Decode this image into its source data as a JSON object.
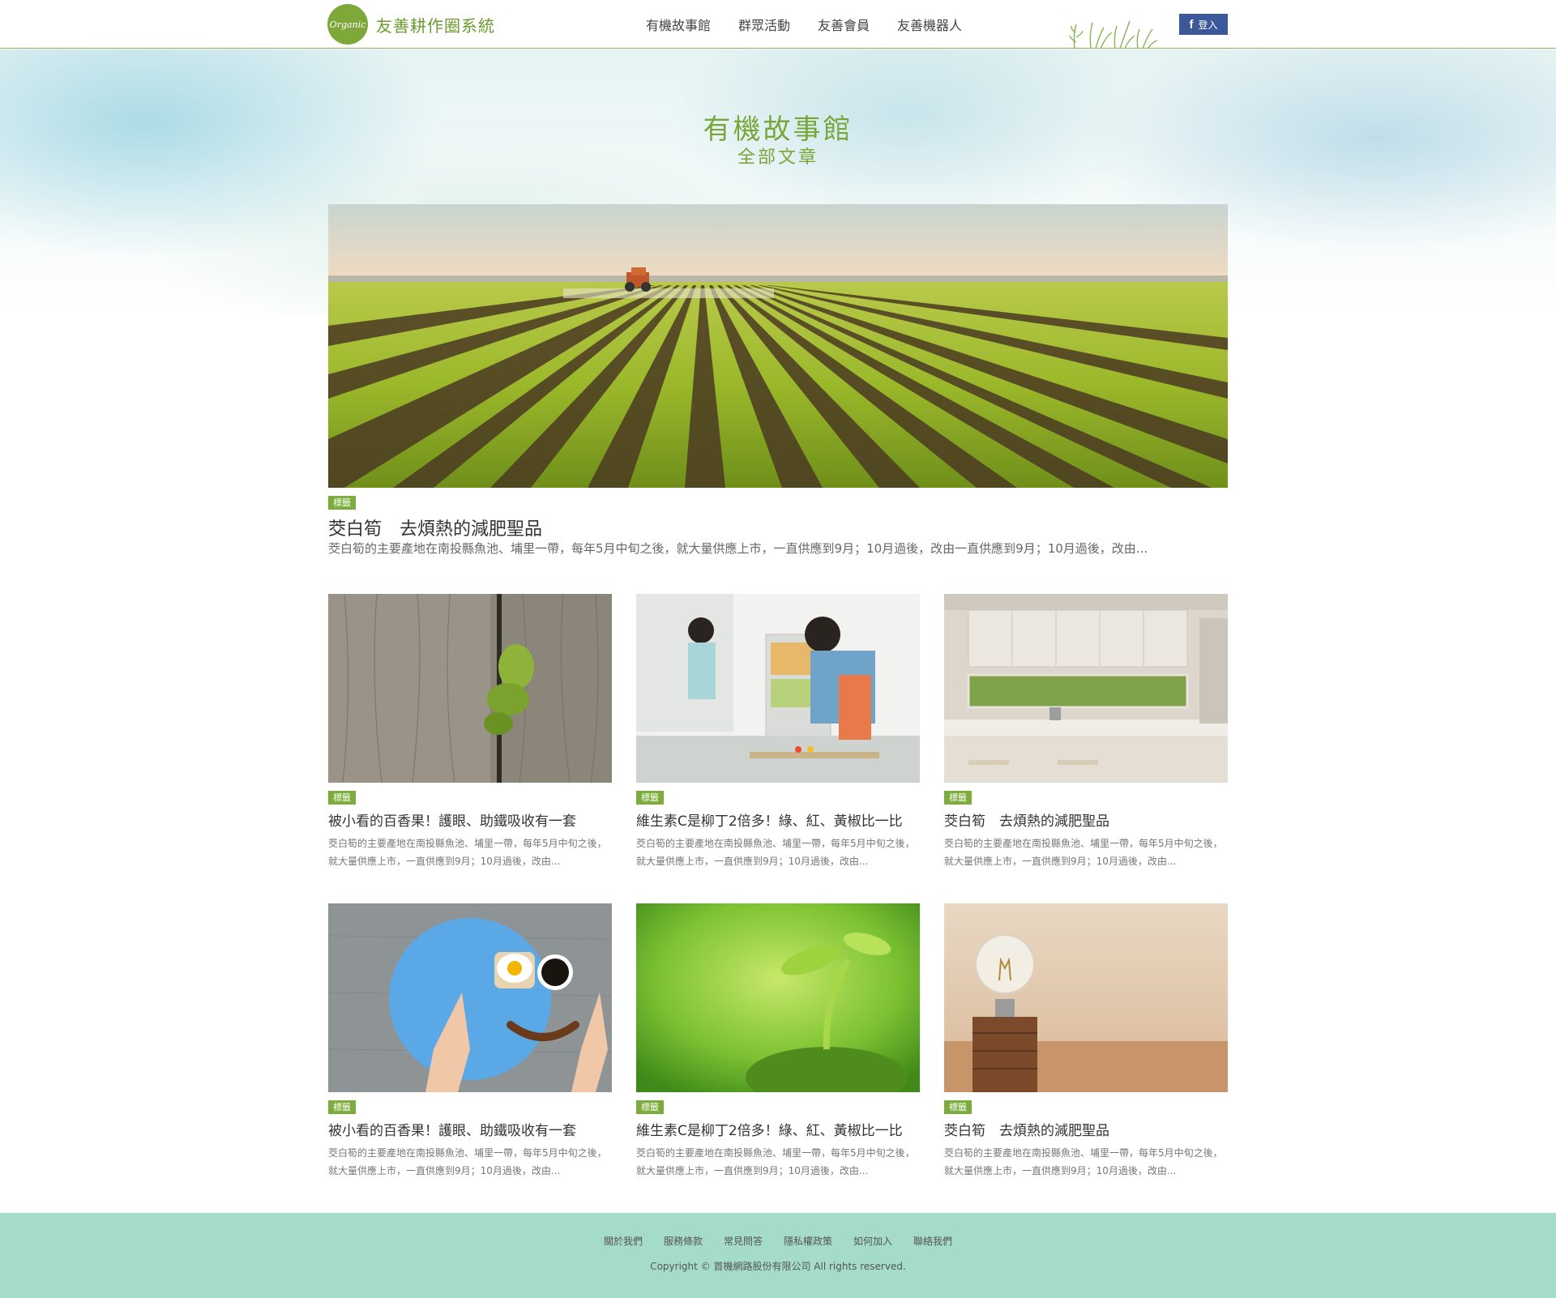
{
  "brand": {
    "logo_text": "Organic",
    "name": "友善耕作圈系統",
    "accent": "#79a63a"
  },
  "nav": {
    "items": [
      "有機故事館",
      "群眾活動",
      "友善會員",
      "友善機器人"
    ]
  },
  "fb_login": {
    "icon": "facebook-icon",
    "label": "登入",
    "color": "#3b5998"
  },
  "hero": {
    "title": "有機故事館",
    "subtitle": "全部文章"
  },
  "featured": {
    "tag": "標籤",
    "title": "茭白筍　去煩熱的減肥聖品",
    "excerpt": "茭白筍的主要產地在南投縣魚池、埔里一帶，每年5月中旬之後，就大量供應上市，一直供應到9月；10月過後，改由一直供應到9月；10月過後，改由..."
  },
  "cards": [
    {
      "tag": "標籤",
      "title": "被小看的百香果！護眼、助鐵吸收有一套",
      "excerpt": "茭白筍的主要產地在南投縣魚池、埔里一帶，每年5月中旬之後，就大量供應上市，一直供應到9月；10月過後，改由..."
    },
    {
      "tag": "標籤",
      "title": "維生素C是柳丁2倍多！綠、紅、黃椒比一比",
      "excerpt": "茭白筍的主要產地在南投縣魚池、埔里一帶，每年5月中旬之後，就大量供應上市，一直供應到9月；10月過後，改由..."
    },
    {
      "tag": "標籤",
      "title": "茭白筍　去煩熱的減肥聖品",
      "excerpt": "茭白筍的主要產地在南投縣魚池、埔里一帶，每年5月中旬之後，就大量供應上市，一直供應到9月；10月過後，改由..."
    },
    {
      "tag": "標籤",
      "title": "被小看的百香果！護眼、助鐵吸收有一套",
      "excerpt": "茭白筍的主要產地在南投縣魚池、埔里一帶，每年5月中旬之後，就大量供應上市，一直供應到9月；10月過後，改由..."
    },
    {
      "tag": "標籤",
      "title": "維生素C是柳丁2倍多！綠、紅、黃椒比一比",
      "excerpt": "茭白筍的主要產地在南投縣魚池、埔里一帶，每年5月中旬之後，就大量供應上市，一直供應到9月；10月過後，改由..."
    },
    {
      "tag": "標籤",
      "title": "茭白筍　去煩熱的減肥聖品",
      "excerpt": "茭白筍的主要產地在南投縣魚池、埔里一帶，每年5月中旬之後，就大量供應上市，一直供應到9月；10月過後，改由..."
    }
  ],
  "footer": {
    "links": [
      "關於我們",
      "服務條款",
      "常見問答",
      "隱私權政策",
      "如何加入",
      "聯絡我們"
    ],
    "copyright": "Copyright © 首機網路股份有限公司 All rights reserved.",
    "background": "#a5dcc9"
  }
}
